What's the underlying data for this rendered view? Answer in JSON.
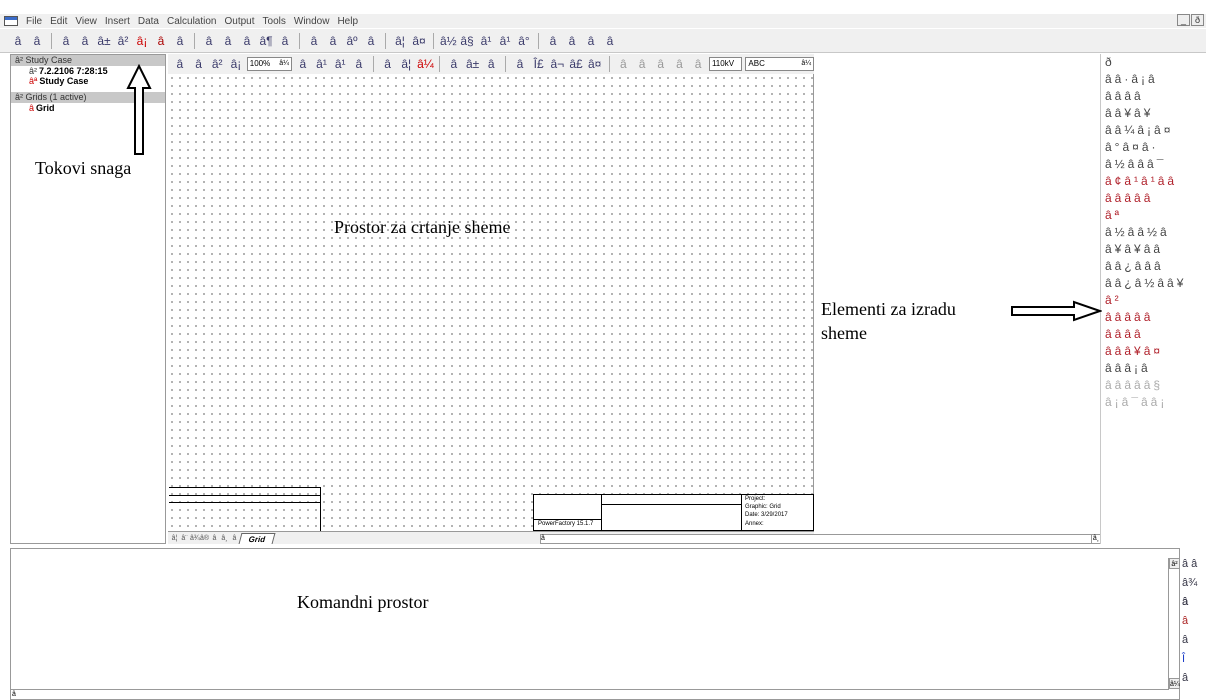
{
  "menu": [
    "File",
    "Edit",
    "View",
    "Insert",
    "Data",
    "Calculation",
    "Output",
    "Tools",
    "Window",
    "Help"
  ],
  "window_controls": [
    "_",
    "ð"
  ],
  "toolbar_main_icons": [
    "page-icon",
    "chart-icon",
    "gear-calc-icon",
    "gear-calc2-icon",
    "report-icon",
    "load-flow-icon",
    "short-circuit-icon",
    "dynamic-icon",
    "harmonics-icon",
    "sim-icon",
    "sim2-icon",
    "reliability-icon",
    "playback-icon",
    "stop-icon",
    "record-icon",
    "fit-icon",
    "undo-icon",
    "graph-icon",
    "table-icon",
    "filter-icon",
    "voltage-icon",
    "tree-icon",
    "tree2-icon",
    "tree3-icon",
    "net-icon",
    "tools-icon",
    "settings-icon"
  ],
  "study_tree": {
    "study_header": "Study Case",
    "datetime": "7.2.2106 7:28:15",
    "study_case": "Study Case",
    "grids_header": "Grids (1 active)",
    "grid": "Grid"
  },
  "annotations": {
    "tokovi": "Tokovi snaga",
    "canvas": "Prostor za crtanje sheme",
    "elements_line1": "Elementi za izradu",
    "elements_line2": "sheme",
    "command": "Komandni prostor"
  },
  "drawing_toolbar": {
    "zoom": "100%",
    "voltage": "110kV",
    "text_style": "ABC"
  },
  "title_block": {
    "software": "PowerFactory 15.1.7",
    "project": "Project:",
    "graphic": "Graphic: Grid",
    "date": "Date:    3/29/2017",
    "annex": "Annex:"
  },
  "tab": "Grid",
  "symbol_rows": [
    "ð ",
    "ââ·â¡â",
    "ââââ",
    "â­â¥â¥",
    "ââ¼â¡â¤",
    "â°â¤â·",
    "â½âââ¯",
    "â¢â¹â¹ââ",
    "âââââ",
    "âª",
    "â½ââ½â",
    "â¥â¥ââ",
    "ââ¿âââ",
    "ââ¿â½ââ¥",
    "â²",
    "âââââ",
    "ââââ",
    "âââ¥â¤",
    "âââ¡â",
    "âââââ§",
    "â¡â¯ââ¡"
  ],
  "cmd_tools": [
    "open-icon",
    "save-icon",
    "copy-icon",
    "paste-icon",
    "find-icon",
    "up-icon",
    "export-icon"
  ]
}
